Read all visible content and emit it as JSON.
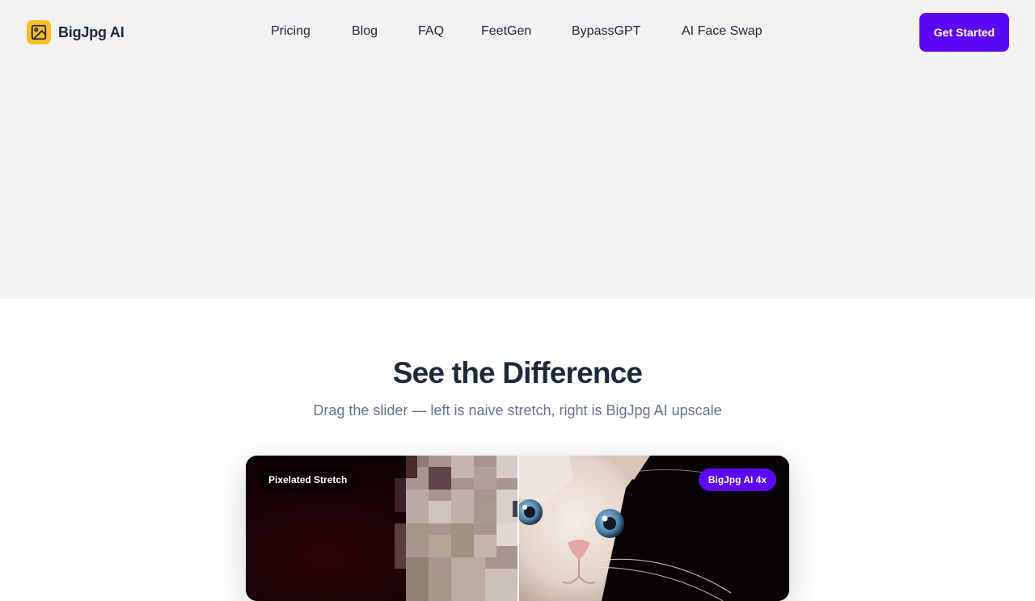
{
  "nav": {
    "brand_name": "BigJpg AI",
    "brand_icon": "image-icon",
    "links": [
      "Pricing",
      "Blog",
      "FAQ",
      "FeetGen",
      "BypassGPT",
      "AI Face Swap"
    ],
    "cta_label": "Get Started"
  },
  "section": {
    "title": "See the Difference",
    "subtitle": "Drag the slider — left is naive stretch, right is BigJpg AI upscale"
  },
  "compare": {
    "left_label": "Pixelated Stretch",
    "right_label": "BigJpg AI 4x",
    "slider_position": 0.5
  },
  "colors": {
    "accent": "#5b09f5",
    "brand_icon_bg": "#fbbf24",
    "header_bg": "#f2f2f2"
  }
}
